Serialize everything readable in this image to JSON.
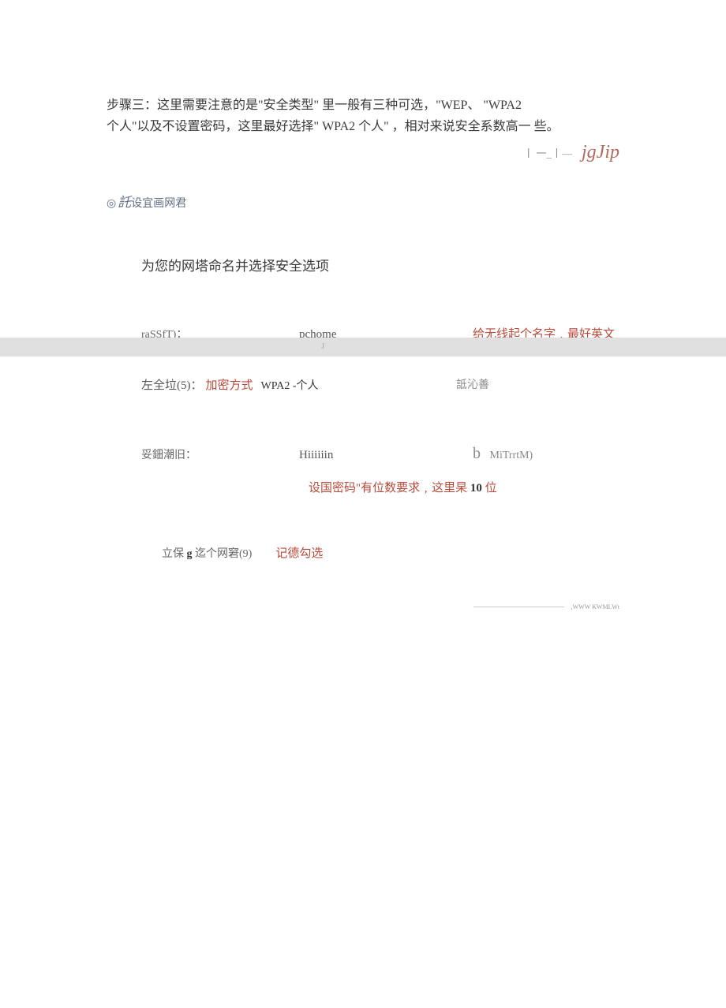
{
  "intro": {
    "line1": "步骤三：这里需要注意的是\"安全类型\" 里一般有三种可选，\"WEP、 \"WPA2",
    "line2": "个人\"以及不设置密码，这里最好选择\" WPA2 个人\" ，相对来说安全系数高一 些。"
  },
  "decoration": {
    "marks": "丨 一_丨—",
    "word": "jgJip"
  },
  "header": {
    "icon": "◎",
    "italic": "託",
    "rest": "设宜画网君"
  },
  "sectionTitle": "为您的网塔命名并选择安全选项",
  "row1": {
    "label": "raSSfT)：",
    "value": "pchome",
    "annotation": "给无线起个名字﹐最好英文"
  },
  "row2": {
    "label": "左全垃(5)：",
    "red": "加密方式",
    "value": "WPA2 -个人",
    "rightSide": "詆沁善"
  },
  "grayBand": {
    "char": "J"
  },
  "row3": {
    "label": "妥鈿潮旧：",
    "value": "Hiiiiiin",
    "bLetter": "b",
    "rightText": "MiTrrtM)"
  },
  "passwordNote": {
    "prefix": "设国密码\"有位数要求﹐这里杲 ",
    "bold": "10",
    "suffix": " 位"
  },
  "row4": {
    "prefix": "立保 ",
    "g": "g",
    "middle": " 迄个网窘(9)",
    "annotation": "记德勾选"
  },
  "footer": ",WWW KWMI.Wt"
}
